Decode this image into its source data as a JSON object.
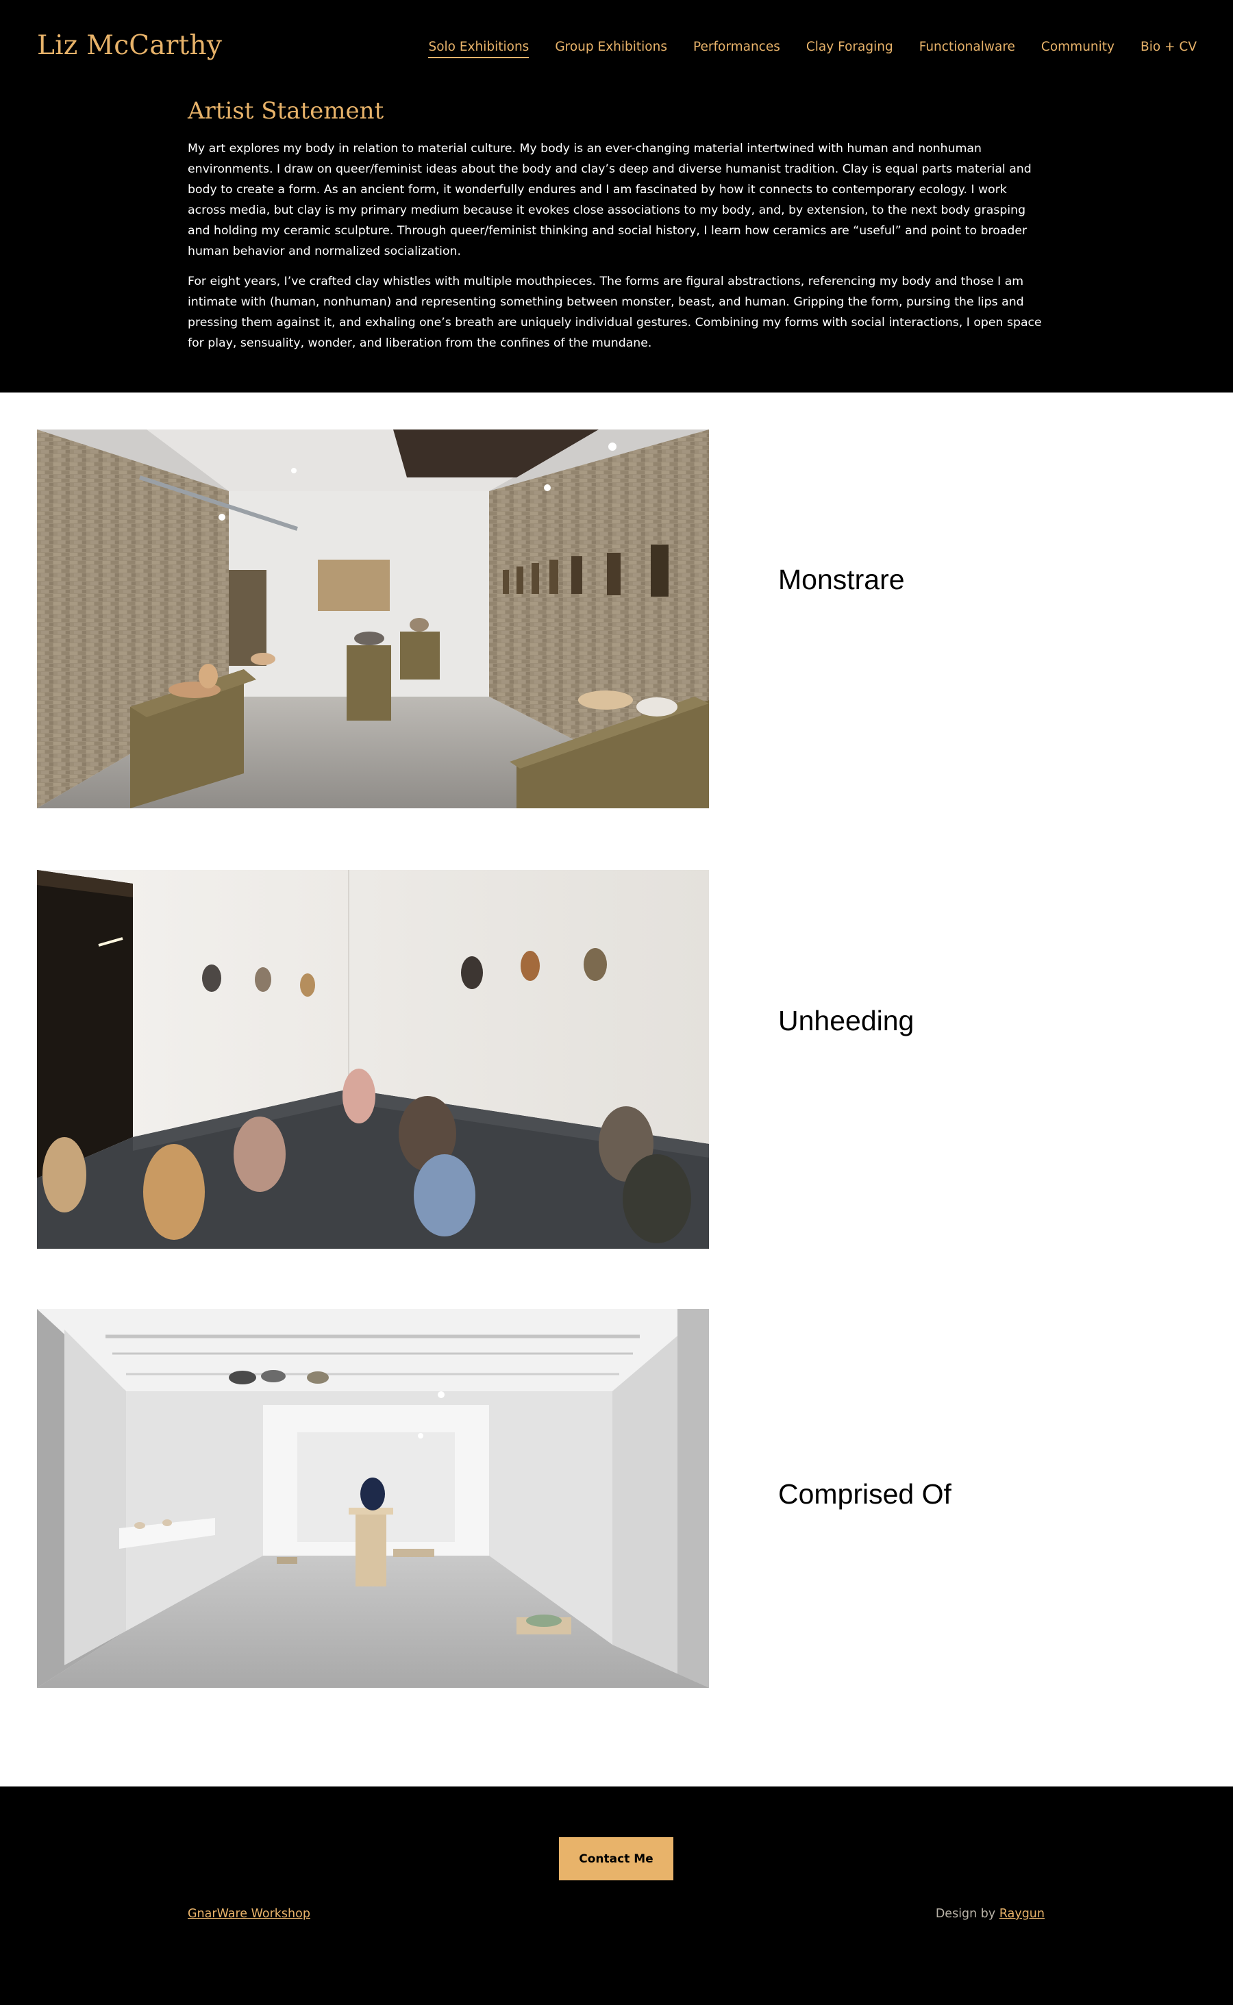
{
  "header": {
    "logo": "Liz McCarthy",
    "nav": [
      {
        "label": "Solo Exhibitions",
        "active": true
      },
      {
        "label": "Group Exhibitions",
        "active": false
      },
      {
        "label": "Performances",
        "active": false
      },
      {
        "label": "Clay Foraging",
        "active": false
      },
      {
        "label": "Functionalware",
        "active": false
      },
      {
        "label": "Community",
        "active": false
      },
      {
        "label": "Bio + CV",
        "active": false
      }
    ]
  },
  "statement": {
    "title": "Artist Statement",
    "paragraphs": [
      "My art explores my body in relation to material culture. My body is an ever-changing material intertwined with human and nonhuman environments. I draw on queer/feminist ideas about the body and clay’s deep and diverse humanist tradition. Clay is equal parts material and body to create a form. As an ancient form, it wonderfully endures and I am fascinated by how it connects to contemporary ecology. I work across media, but clay is my primary medium because it evokes close associations to my body, and, by extension, to the next body grasping and holding my ceramic sculpture. Through queer/feminist thinking and social history, I learn how ceramics are “useful” and point to broader human behavior and normalized socialization.",
      "For eight years, I’ve crafted clay whistles with multiple mouthpieces. The forms are figural abstractions, referencing my body and those I am intimate with (human, nonhuman) and representing something between monster, beast, and human. Gripping the form, pursing the lips and pressing them against it, and exhaling one’s breath are uniquely individual gestures. Combining my forms with social interactions, I open space for play, sensuality, wonder, and liberation from the confines of the mundane."
    ]
  },
  "exhibitions": [
    {
      "title": "Monstrare",
      "image": "gallery-brick-walls-photo"
    },
    {
      "title": "Unheeding",
      "image": "gallery-figures-floor-photo"
    },
    {
      "title": "Comprised Of",
      "image": "white-gallery-corridor-photo"
    }
  ],
  "footer": {
    "contact_label": "Contact Me",
    "left_link": "GnarWare Workshop",
    "design_prefix": "Design by ",
    "design_link": "Raygun"
  },
  "colors": {
    "accent": "#e8b36a",
    "background_dark": "#000000",
    "background_light": "#ffffff"
  }
}
